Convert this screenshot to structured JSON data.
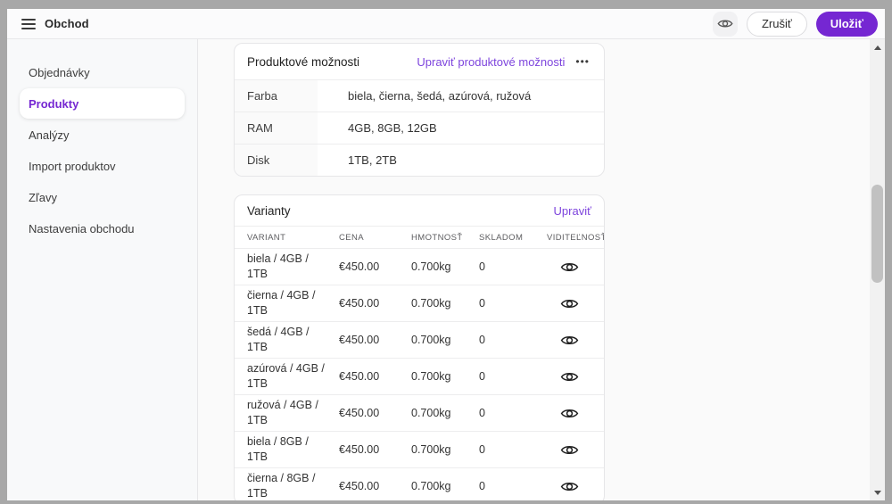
{
  "colors": {
    "accent": "#7527d2",
    "link": "#7d44dd"
  },
  "topbar": {
    "title": "Obchod",
    "cancel_label": "Zrušiť",
    "save_label": "Uložiť"
  },
  "icons": {
    "more_options": "•••",
    "preview": "eye",
    "visibility": "eye",
    "menu": "hamburger"
  },
  "sidebar": {
    "items": [
      {
        "label": "Objednávky",
        "active": false
      },
      {
        "label": "Produkty",
        "active": true
      },
      {
        "label": "Analýzy",
        "active": false
      },
      {
        "label": "Import produktov",
        "active": false
      },
      {
        "label": "Zľavy",
        "active": false
      },
      {
        "label": "Nastavenia obchodu",
        "active": false
      }
    ]
  },
  "options_card": {
    "title": "Produktové možnosti",
    "edit_link": "Upraviť produktové možnosti",
    "rows": [
      {
        "label": "Farba",
        "value": "biela, čierna, šedá, azúrová, ružová"
      },
      {
        "label": "RAM",
        "value": "4GB, 8GB, 12GB"
      },
      {
        "label": "Disk",
        "value": "1TB, 2TB"
      }
    ]
  },
  "variants_card": {
    "title": "Varianty",
    "edit_link": "Upraviť",
    "columns": [
      "Variant",
      "Cena",
      "Hmotnosť",
      "Skladom",
      "Viditeľnosť"
    ],
    "rows": [
      {
        "variant": "biela / 4GB / 1TB",
        "price": "€450.00",
        "weight": "0.700kg",
        "stock": "0"
      },
      {
        "variant": "čierna / 4GB / 1TB",
        "price": "€450.00",
        "weight": "0.700kg",
        "stock": "0"
      },
      {
        "variant": "šedá / 4GB / 1TB",
        "price": "€450.00",
        "weight": "0.700kg",
        "stock": "0"
      },
      {
        "variant": "azúrová / 4GB / 1TB",
        "price": "€450.00",
        "weight": "0.700kg",
        "stock": "0"
      },
      {
        "variant": "ružová / 4GB / 1TB",
        "price": "€450.00",
        "weight": "0.700kg",
        "stock": "0"
      },
      {
        "variant": "biela / 8GB / 1TB",
        "price": "€450.00",
        "weight": "0.700kg",
        "stock": "0"
      },
      {
        "variant": "čierna / 8GB / 1TB",
        "price": "€450.00",
        "weight": "0.700kg",
        "stock": "0"
      }
    ]
  }
}
